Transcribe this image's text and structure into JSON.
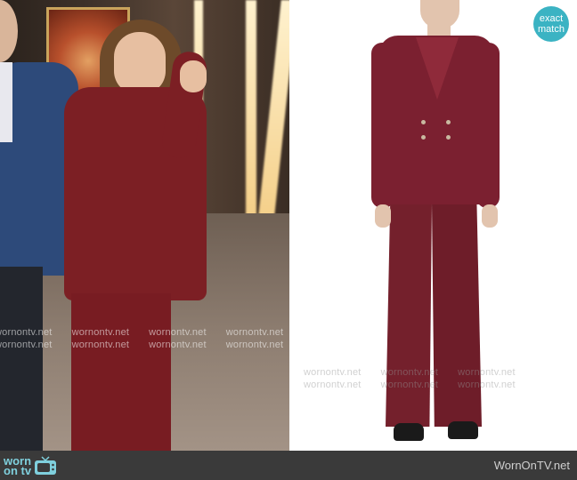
{
  "badge": {
    "line1": "exact",
    "line2": "match"
  },
  "watermark": {
    "text": "wornontv.net"
  },
  "footer": {
    "logo_top": "worn",
    "logo_bottom": "on tv",
    "site": "WornOnTV.net"
  },
  "colors": {
    "accent": "#3bb3c3",
    "suit": "#7b2030",
    "footer_bg": "#3a3a3a"
  }
}
